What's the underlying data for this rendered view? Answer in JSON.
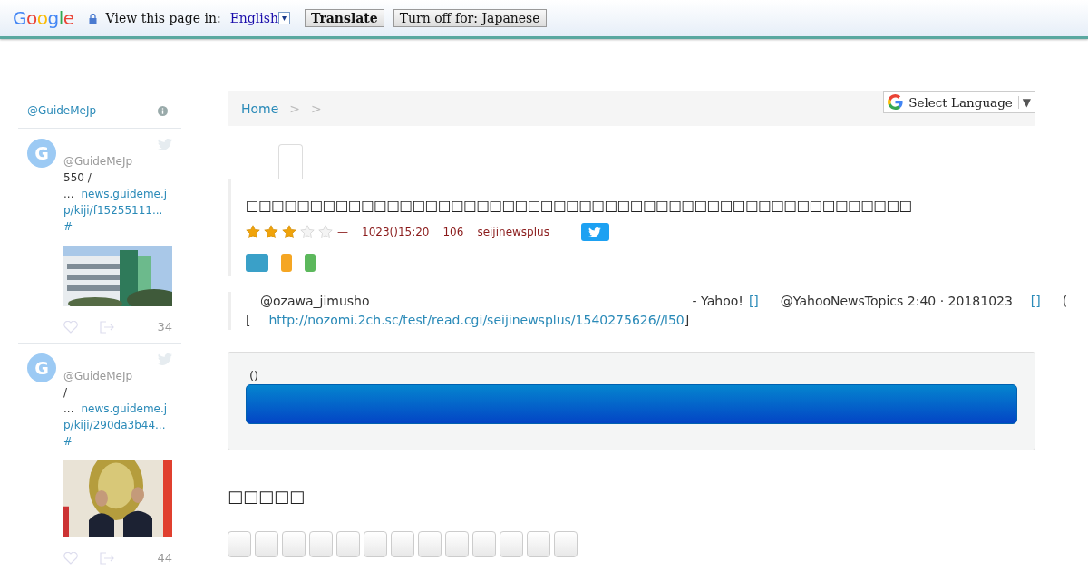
{
  "translate_bar": {
    "logo": "Google",
    "prompt": "View this page in:",
    "language": "English",
    "dropdown_glyph": "▾",
    "translate_button": "Translate",
    "turn_off_button": "Turn off for: Japanese"
  },
  "sidebar": {
    "header": "@GuideMeJp",
    "tweets": [
      {
        "avatar": "G",
        "handle": "@GuideMeJp",
        "text": "550 /",
        "lead": "...",
        "link_lines": [
          "news.guideme.j",
          "p/kiji/f15255111..."
        ],
        "hashtag": "#",
        "count": "34"
      },
      {
        "avatar": "G",
        "handle": "@GuideMeJp",
        "text": " /",
        "lead": "...",
        "link_lines": [
          "news.guideme.j",
          "p/kiji/290da3b44..."
        ],
        "hashtag": "#",
        "count": "44"
      }
    ]
  },
  "breadcrumb": [
    "Home",
    ">",
    ">"
  ],
  "language_select": {
    "label": "Select Language",
    "arrow": "▼"
  },
  "article": {
    "title": "□□□□□□□□□□□□□□□□□□□□□□□□□□□□□□□□□□□□□□□□□□□□□□□□□□□□",
    "stars": 3,
    "dash": "—",
    "date": "1023()15:20",
    "count": "106",
    "board": "seijinewsplus",
    "badges": [
      {
        "label": "!",
        "color": "#3aa0c8"
      },
      {
        "color": "#f5a623"
      },
      {
        "color": "#5cb85c"
      }
    ],
    "body_line_1": [
      {
        "kind": "text",
        "text": "@ozawa_jimusho"
      },
      {
        "kind": "text",
        "text": "- Yahoo!"
      },
      {
        "kind": "link",
        "text": "[]"
      },
      {
        "kind": "text",
        "text": "@YahooNewsTopics 2:40 · 20181023"
      },
      {
        "kind": "link",
        "text": "[]"
      },
      {
        "kind": "text",
        "text": "("
      }
    ],
    "body_line_2": [
      {
        "kind": "text",
        "text": "["
      },
      {
        "kind": "link",
        "text": "http://nozomi.2ch.sc/test/read.cgi/seijinewsplus/1540275626//l50"
      },
      {
        "kind": "text",
        "text": "]"
      }
    ]
  },
  "action_panel": {
    "label": "()"
  },
  "section_heading": "□□□□□",
  "share_buttons": [
    {
      "kind": "blank"
    },
    {
      "kind": "blank"
    },
    {
      "kind": "blank"
    },
    {
      "kind": "blank"
    },
    {
      "kind": "blank"
    },
    {
      "kind": "blank"
    },
    {
      "kind": "blank"
    },
    {
      "kind": "blank"
    },
    {
      "kind": "blank"
    },
    {
      "kind": "blank"
    },
    {
      "kind": "blank"
    },
    {
      "kind": "blank"
    },
    {
      "kind": "blank"
    }
  ]
}
